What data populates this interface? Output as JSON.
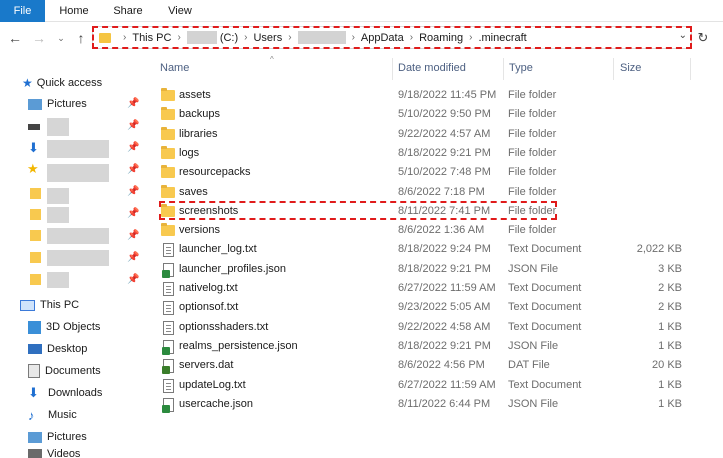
{
  "ribbon": {
    "tabs": [
      {
        "label": "File"
      },
      {
        "label": "Home"
      },
      {
        "label": "Share"
      },
      {
        "label": "View"
      }
    ]
  },
  "address_bar": {
    "crumbs": [
      "This PC",
      "(C:)",
      "Users",
      "AppData",
      "Roaming",
      ".minecraft"
    ],
    "separator": "›"
  },
  "sidebar": {
    "quick_access": "Quick access",
    "pictures": "Pictures",
    "this_pc": "This PC",
    "items": [
      {
        "label": "3D Objects",
        "icon": "3d-objects-icon"
      },
      {
        "label": "Desktop",
        "icon": "desktop-icon"
      },
      {
        "label": "Documents",
        "icon": "documents-icon"
      },
      {
        "label": "Downloads",
        "icon": "downloads-icon"
      },
      {
        "label": "Music",
        "icon": "music-icon"
      },
      {
        "label": "Pictures",
        "icon": "pictures-icon"
      },
      {
        "label": "Videos",
        "icon": "videos-icon"
      }
    ]
  },
  "columns": {
    "name": "Name",
    "date": "Date modified",
    "type": "Type",
    "size": "Size"
  },
  "files": [
    {
      "name": "assets",
      "date": "9/18/2022 11:45 PM",
      "type": "File folder",
      "size": "",
      "icon": "folder"
    },
    {
      "name": "backups",
      "date": "5/10/2022 9:50 PM",
      "type": "File folder",
      "size": "",
      "icon": "folder"
    },
    {
      "name": "libraries",
      "date": "9/22/2022 4:57 AM",
      "type": "File folder",
      "size": "",
      "icon": "folder"
    },
    {
      "name": "logs",
      "date": "8/18/2022 9:21 PM",
      "type": "File folder",
      "size": "",
      "icon": "folder"
    },
    {
      "name": "resourcepacks",
      "date": "5/10/2022 7:48 PM",
      "type": "File folder",
      "size": "",
      "icon": "folder"
    },
    {
      "name": "saves",
      "date": "8/6/2022 7:18 PM",
      "type": "File folder",
      "size": "",
      "icon": "folder"
    },
    {
      "name": "screenshots",
      "date": "8/11/2022 7:41 PM",
      "type": "File folder",
      "size": "",
      "icon": "folder"
    },
    {
      "name": "versions",
      "date": "8/6/2022 1:36 AM",
      "type": "File folder",
      "size": "",
      "icon": "folder"
    },
    {
      "name": "launcher_log.txt",
      "date": "8/18/2022 9:24 PM",
      "type": "Text Document",
      "size": "2,022 KB",
      "icon": "doc"
    },
    {
      "name": "launcher_profiles.json",
      "date": "8/18/2022 9:21 PM",
      "type": "JSON File",
      "size": "3 KB",
      "icon": "json"
    },
    {
      "name": "nativelog.txt",
      "date": "6/27/2022 11:59 AM",
      "type": "Text Document",
      "size": "2 KB",
      "icon": "doc"
    },
    {
      "name": "optionsof.txt",
      "date": "9/23/2022 5:05 AM",
      "type": "Text Document",
      "size": "2 KB",
      "icon": "doc"
    },
    {
      "name": "optionsshaders.txt",
      "date": "9/22/2022 4:58 AM",
      "type": "Text Document",
      "size": "1 KB",
      "icon": "doc"
    },
    {
      "name": "realms_persistence.json",
      "date": "8/18/2022 9:21 PM",
      "type": "JSON File",
      "size": "1 KB",
      "icon": "json"
    },
    {
      "name": "servers.dat",
      "date": "8/6/2022 4:56 PM",
      "type": "DAT File",
      "size": "20 KB",
      "icon": "dat"
    },
    {
      "name": "updateLog.txt",
      "date": "6/27/2022 11:59 AM",
      "type": "Text Document",
      "size": "1 KB",
      "icon": "doc"
    },
    {
      "name": "usercache.json",
      "date": "8/11/2022 6:44 PM",
      "type": "JSON File",
      "size": "1 KB",
      "icon": "json"
    }
  ],
  "colors": {
    "file_tab": "#1979ca",
    "folder": "#f8c94f",
    "highlight": "#e01b1b",
    "header_text": "#4d6082"
  }
}
